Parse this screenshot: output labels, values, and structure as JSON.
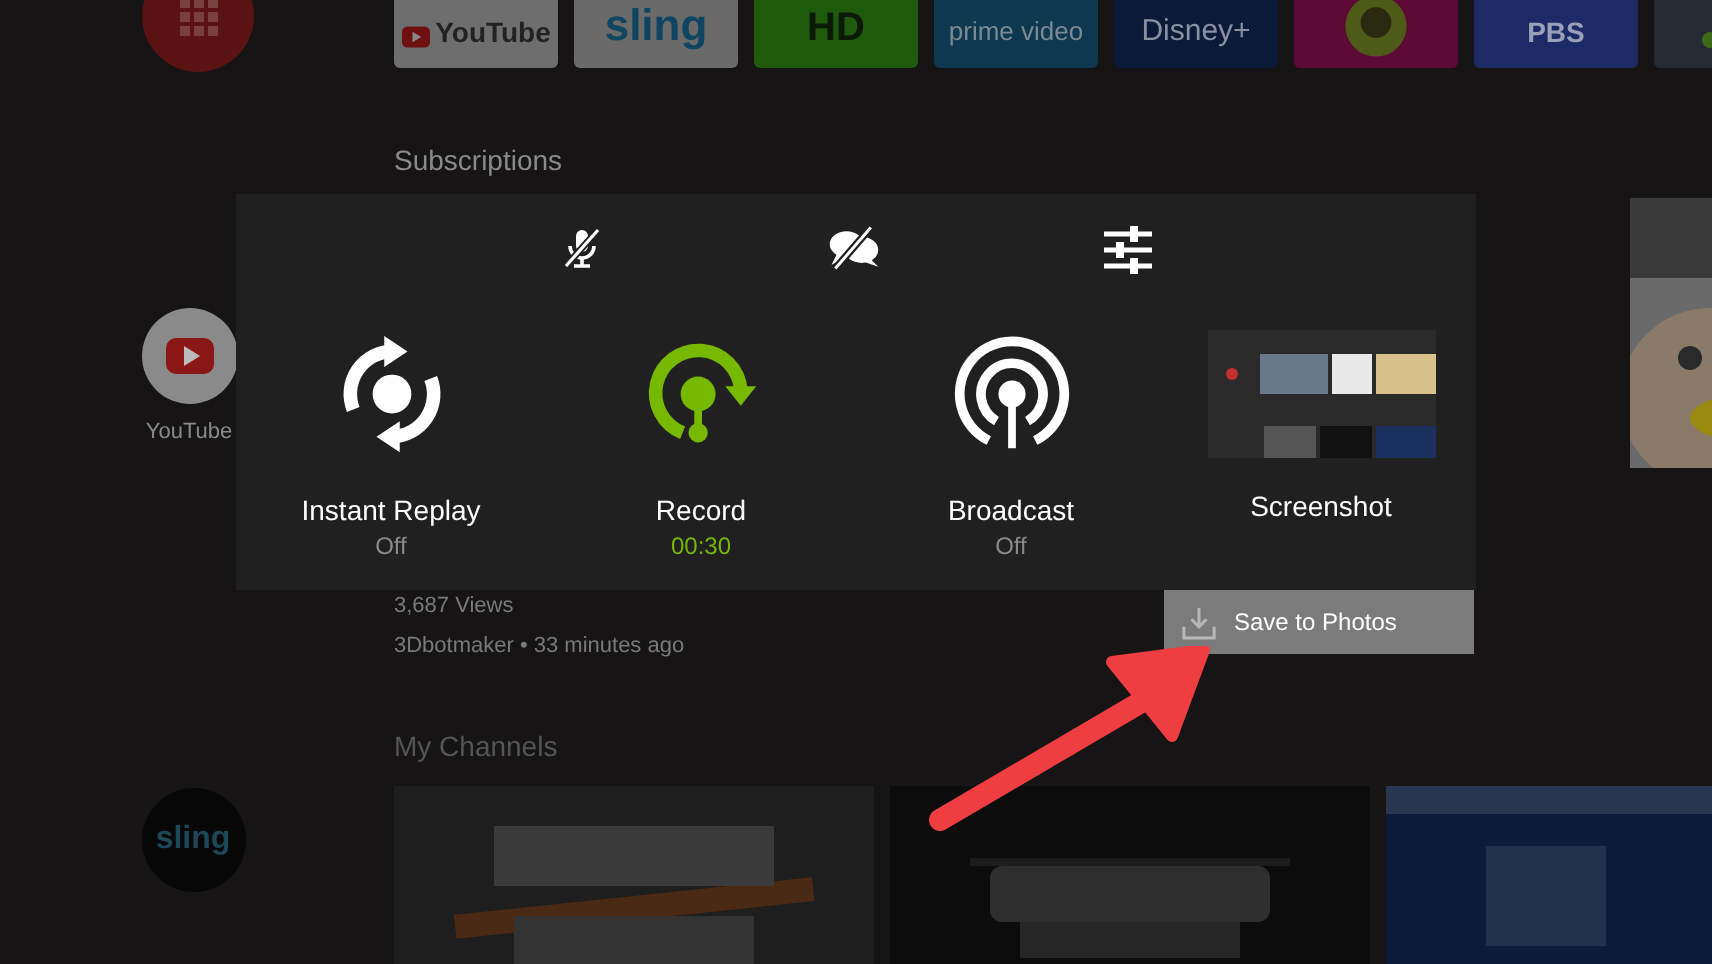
{
  "top_apps": [
    {
      "kind": "youtube",
      "label": "YouTube"
    },
    {
      "kind": "sling",
      "label": "sling"
    },
    {
      "kind": "hd",
      "label": "HD"
    },
    {
      "kind": "prime",
      "label": "prime video"
    },
    {
      "kind": "disney",
      "label": "Disney+"
    },
    {
      "kind": "pbs-kids"
    },
    {
      "kind": "pbs",
      "label": "PBS"
    },
    {
      "kind": "blank"
    }
  ],
  "subscriptions": {
    "title": "Subscriptions",
    "channel": "YouTube",
    "views": "3,687 Views",
    "meta": "3Dbotmaker • 33 minutes ago"
  },
  "my_channels": {
    "title": "My Channels",
    "channel": "sling"
  },
  "overlay": {
    "toggles": [
      {
        "kind": "mic",
        "on": false
      },
      {
        "kind": "chat",
        "on": false
      },
      {
        "kind": "settings"
      }
    ],
    "features": [
      {
        "kind": "replay",
        "label": "Instant Replay",
        "status": "Off",
        "active": false
      },
      {
        "kind": "record",
        "label": "Record",
        "status": "00:30",
        "active": true
      },
      {
        "kind": "broadcast",
        "label": "Broadcast",
        "status": "Off",
        "active": false
      },
      {
        "kind": "screenshot",
        "label": "Screenshot"
      }
    ],
    "popup": {
      "label": "Save to Photos"
    }
  }
}
